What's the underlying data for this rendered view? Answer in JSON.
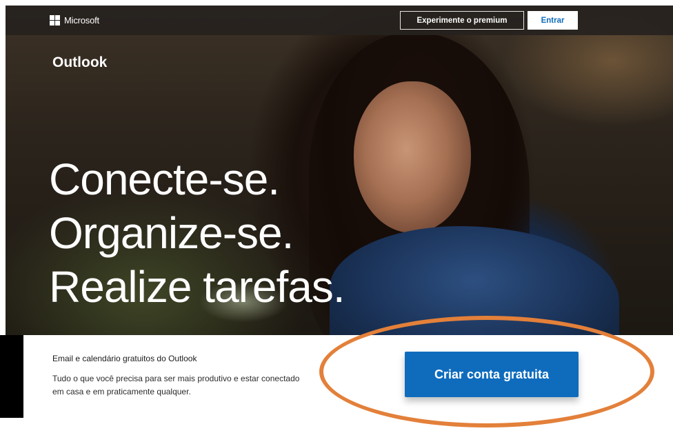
{
  "header": {
    "brand": "Microsoft",
    "premium_button": "Experimente o premium",
    "signin_button": "Entrar"
  },
  "hero": {
    "product": "Outlook",
    "headline": [
      "Conecte-se.",
      "Organize-se.",
      "Realize tarefas."
    ]
  },
  "info": {
    "title": "Email e calendário gratuitos do Outlook",
    "description": "Tudo o que você precisa para ser mais produtivo e estar conectado em casa e em praticamente qualquer.",
    "cta": "Criar conta gratuita"
  },
  "colors": {
    "accent_blue": "#0f6cbd",
    "highlight_orange": "#e3803a"
  }
}
